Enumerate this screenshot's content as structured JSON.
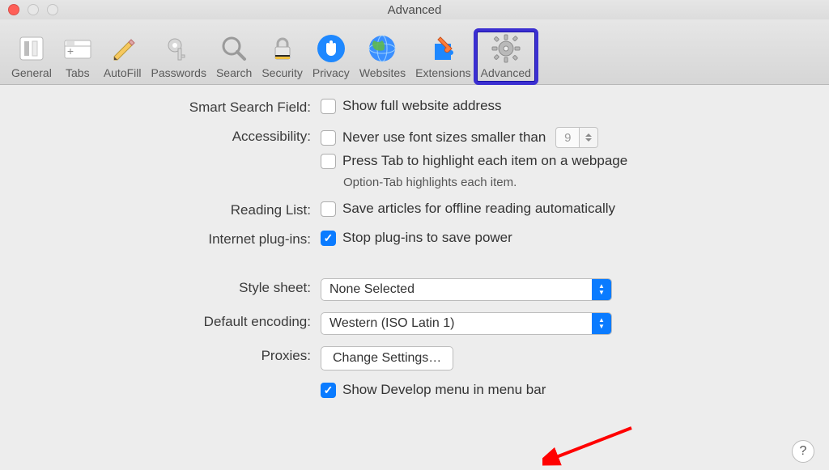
{
  "window": {
    "title": "Advanced"
  },
  "toolbar": {
    "items": [
      {
        "id": "general",
        "label": "General"
      },
      {
        "id": "tabs",
        "label": "Tabs"
      },
      {
        "id": "autofill",
        "label": "AutoFill"
      },
      {
        "id": "passwords",
        "label": "Passwords"
      },
      {
        "id": "search",
        "label": "Search"
      },
      {
        "id": "security",
        "label": "Security"
      },
      {
        "id": "privacy",
        "label": "Privacy"
      },
      {
        "id": "websites",
        "label": "Websites"
      },
      {
        "id": "extensions",
        "label": "Extensions"
      },
      {
        "id": "advanced",
        "label": "Advanced"
      }
    ],
    "selected": "advanced"
  },
  "sections": {
    "smart_search": {
      "label": "Smart Search Field:",
      "show_full_url": {
        "checked": false,
        "text": "Show full website address"
      }
    },
    "accessibility": {
      "label": "Accessibility:",
      "min_font": {
        "checked": false,
        "text": "Never use font sizes smaller than",
        "value": "9"
      },
      "press_tab": {
        "checked": false,
        "text": "Press Tab to highlight each item on a webpage"
      },
      "note": "Option-Tab highlights each item."
    },
    "reading_list": {
      "label": "Reading List:",
      "offline": {
        "checked": false,
        "text": "Save articles for offline reading automatically"
      }
    },
    "plugins": {
      "label": "Internet plug-ins:",
      "stop_plugins": {
        "checked": true,
        "text": "Stop plug-ins to save power"
      }
    },
    "style_sheet": {
      "label": "Style sheet:",
      "value": "None Selected"
    },
    "encoding": {
      "label": "Default encoding:",
      "value": "Western (ISO Latin 1)"
    },
    "proxies": {
      "label": "Proxies:",
      "button": "Change Settings…"
    },
    "develop": {
      "checked": true,
      "text": "Show Develop menu in menu bar"
    }
  },
  "help": "?"
}
